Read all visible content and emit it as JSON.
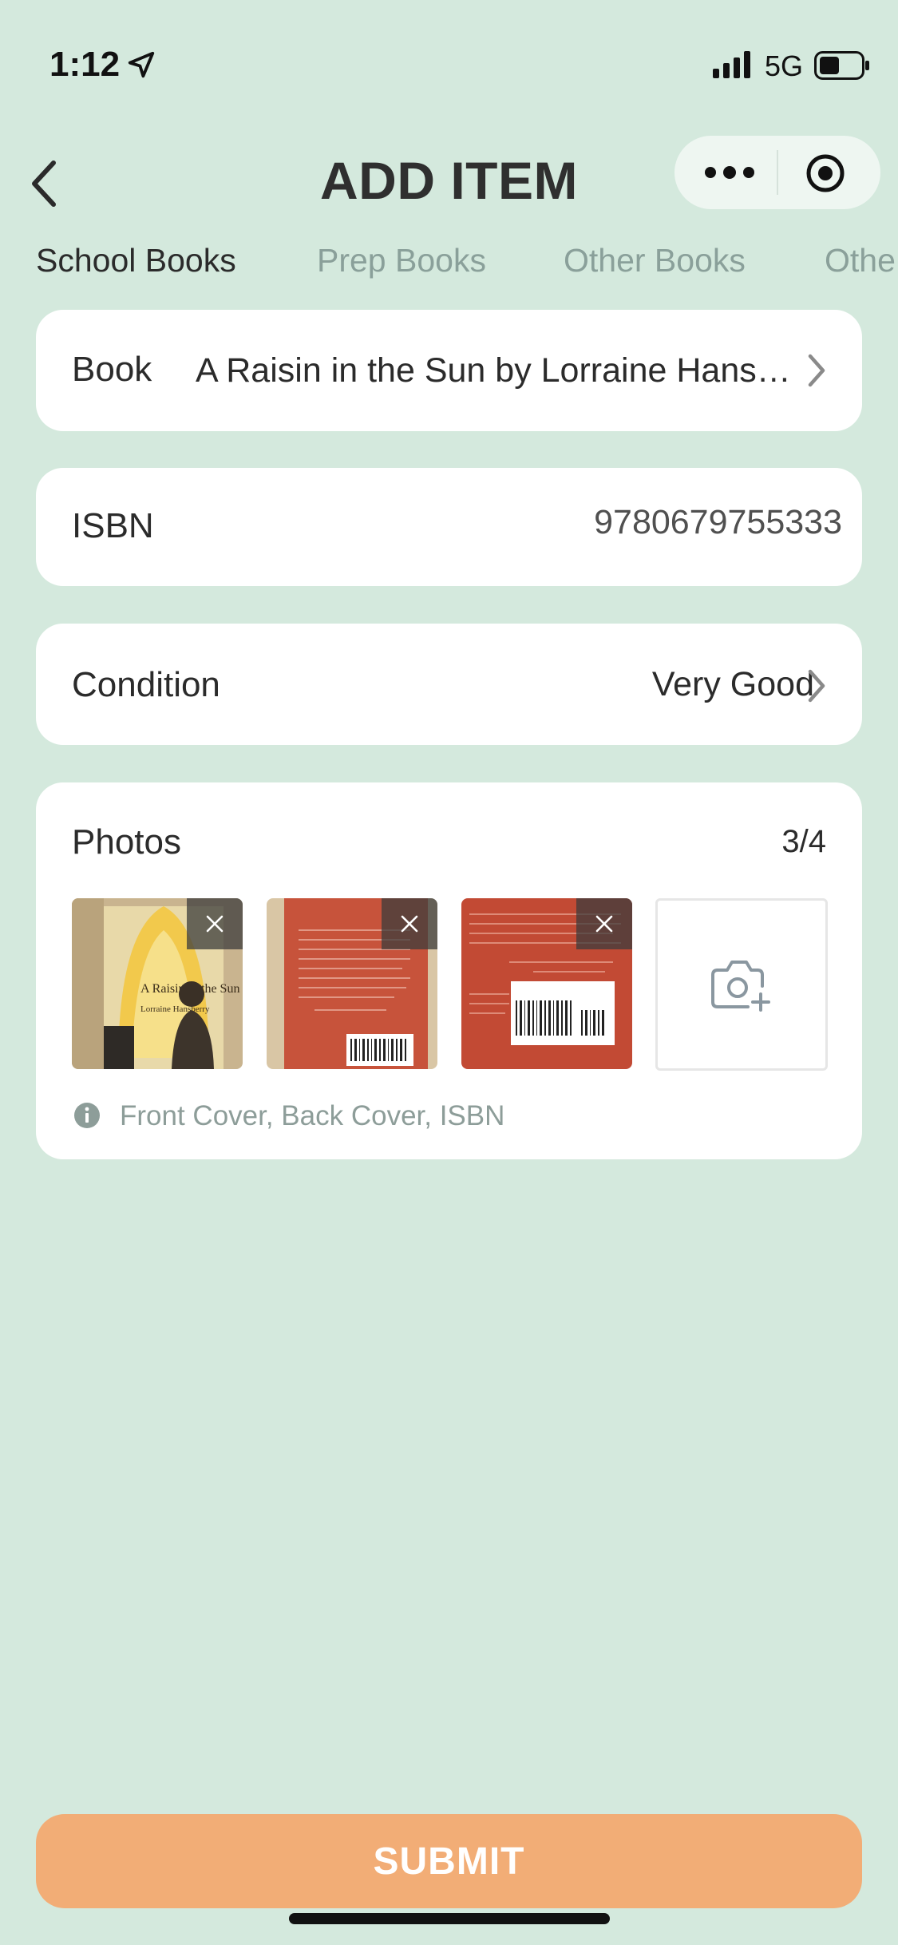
{
  "status_bar": {
    "time": "1:12",
    "network": "5G",
    "icons": [
      "location-arrow-icon",
      "signal-bars-icon",
      "battery-icon"
    ]
  },
  "header": {
    "title": "ADD ITEM",
    "icons": [
      "back-chevron-icon",
      "more-dots-icon",
      "target-circle-icon"
    ]
  },
  "tabs": [
    {
      "label": "School Books",
      "active": true
    },
    {
      "label": "Prep Books",
      "active": false
    },
    {
      "label": "Other Books",
      "active": false
    },
    {
      "label": "Othe",
      "active": false
    }
  ],
  "form": {
    "book": {
      "label": "Book",
      "value": "A Raisin in the Sun by Lorraine Hans…"
    },
    "isbn": {
      "label": "ISBN",
      "value": "9780679755333"
    },
    "condition": {
      "label": "Condition",
      "value": "Very Good"
    },
    "photos": {
      "label": "Photos",
      "count": "3/4",
      "thumbnails": [
        {
          "cover_title": "A Raisin in the Sun",
          "cover_author": "Lorraine Hansberry"
        },
        {
          "kind": "back cover"
        },
        {
          "kind": "ISBN barcode"
        }
      ],
      "hint": "Front Cover, Back Cover, ISBN"
    }
  },
  "submit_label": "SUBMIT",
  "colors": {
    "background": "#d4e9dd",
    "accent": "#f2ad76",
    "muted_text": "#8aa09a"
  }
}
